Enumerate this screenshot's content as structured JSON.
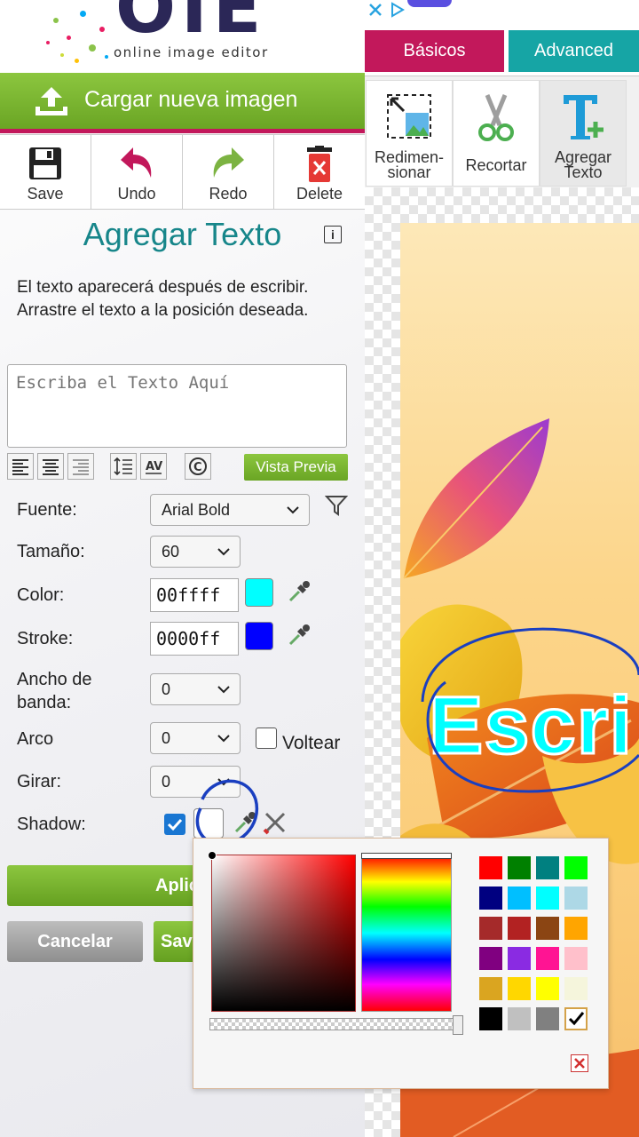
{
  "logo": {
    "word": "OIE",
    "tagline": "online image editor"
  },
  "upload_button": {
    "label": "Cargar nueva imagen"
  },
  "toolbar": [
    {
      "label": "Save",
      "icon": "floppy-disk-icon"
    },
    {
      "label": "Undo",
      "icon": "undo-arrow-icon"
    },
    {
      "label": "Redo",
      "icon": "redo-arrow-icon"
    },
    {
      "label": "Delete",
      "icon": "trash-icon"
    }
  ],
  "tabs": [
    {
      "label": "Básicos",
      "color": "#c2185b",
      "active": true
    },
    {
      "label": "Advanced",
      "color": "#16a5a5",
      "active": false
    }
  ],
  "tools": [
    {
      "label_line1": "Redimen-",
      "label_line2": "sionar",
      "icon": "resize-icon"
    },
    {
      "label_line1": "Recortar",
      "label_line2": "",
      "icon": "scissors-icon"
    },
    {
      "label_line1": "Agregar",
      "label_line2": "Texto",
      "icon": "add-text-icon",
      "active": true
    }
  ],
  "panel": {
    "title": "Agregar Texto",
    "info_icon": "i",
    "description": "El texto aparecerá después de escribir. Arrastre el texto a la posición deseada.",
    "text_placeholder": "Escriba el Texto Aquí",
    "preview_button": "Vista Previa",
    "fields": {
      "font_label": "Fuente:",
      "font_value": "Arial Bold",
      "size_label": "Tamaño:",
      "size_value": "60",
      "color_label": "Color:",
      "color_value": "00ffff",
      "color_swatch": "#00ffff",
      "stroke_label": "Stroke:",
      "stroke_value": "0000ff",
      "stroke_swatch": "#0000ff",
      "band_label_line1": "Ancho de",
      "band_label_line2": "banda:",
      "band_value": "0",
      "arc_label": "Arco",
      "arc_value": "0",
      "flip_label": "Voltear",
      "flip_checked": false,
      "rotate_label": "Girar:",
      "rotate_value": "0",
      "shadow_label": "Shadow:",
      "shadow_checked": true,
      "shadow_swatch": "#ffffff"
    },
    "buttons": {
      "apply": "Aplic",
      "cancel": "Cancelar",
      "save": "Sav"
    }
  },
  "canvas": {
    "text": "Escri",
    "text_color": "#00ffff"
  },
  "color_picker": {
    "palette": [
      "#ff0000",
      "#008000",
      "#008080",
      "#00ff00",
      "#000080",
      "#00bfff",
      "#00ffff",
      "#add8e6",
      "#a52a2a",
      "#b22222",
      "#8b4513",
      "#ffa500",
      "#800080",
      "#8a2be2",
      "#ff1493",
      "#ffc0cb",
      "#daa520",
      "#ffd700",
      "#ffff00",
      "#f5f5dc",
      "#000000",
      "#c0c0c0",
      "#808080",
      "#ffffff"
    ],
    "selected_index": 23
  }
}
